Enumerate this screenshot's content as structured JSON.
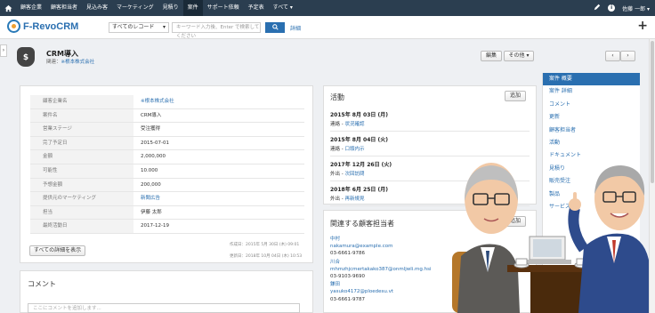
{
  "topnav": {
    "items": [
      "顧客企業",
      "顧客担当者",
      "見込み客",
      "マーケティング",
      "見積り",
      "案件",
      "サポート依頼",
      "予定表",
      "すべて ▾"
    ],
    "active_index": 5,
    "user": "佐藤 一郎 ▾"
  },
  "header": {
    "logo_text": "F-RevoCRM",
    "scope": "すべてのレコード",
    "search_placeholder": "キーワード入力後、Enter で検索してください",
    "advanced": "詳細"
  },
  "record": {
    "title": "CRM導入",
    "related_label": "関連：",
    "related_value": "※根本株式会社",
    "edit_button": "編集",
    "more_button": "その他 ▾"
  },
  "details": {
    "rows": [
      {
        "key": "顧客企業名",
        "value": "※根本株式会社",
        "link": true
      },
      {
        "key": "案件名",
        "value": "CRM導入",
        "link": false
      },
      {
        "key": "営業ステージ",
        "value": "受注獲得",
        "link": false
      },
      {
        "key": "完了予定日",
        "value": "2015-07-01",
        "link": false
      },
      {
        "key": "金額",
        "value": "2,000,000",
        "link": false
      },
      {
        "key": "可能性",
        "value": "10.000",
        "link": false
      },
      {
        "key": "予想金額",
        "value": "200,000",
        "link": false
      },
      {
        "key": "提供元のマーケティング",
        "value": "新聞広告",
        "link": true
      },
      {
        "key": "担当",
        "value": "伊藤 太郎",
        "link": false
      },
      {
        "key": "最終活動日",
        "value": "2017-12-19",
        "link": false
      }
    ],
    "all_details_button": "すべての詳細を表示",
    "created": "作成日：2015年 5月 30日 (木) 09:01",
    "modified": "更新日：2018年 10月 04日 (木) 10:53"
  },
  "comments": {
    "title": "コメント",
    "placeholder": "ここにコメントを追加します..."
  },
  "activities": {
    "title": "活動",
    "add_button": "追加",
    "items": [
      {
        "date": "2015年 8月 03日 (月)",
        "type": "連絡 - ",
        "subject": "状況確認"
      },
      {
        "date": "2015年 8月 04日 (火)",
        "type": "連絡 - ",
        "subject": "口頭内示"
      },
      {
        "date": "2017年 12月 26日 (火)",
        "type": "外出 - ",
        "subject": "次回訪問"
      },
      {
        "date": "2018年 6月 25日 (月)",
        "type": "外出 - ",
        "subject": "再新規見"
      }
    ]
  },
  "contacts": {
    "title": "関連する顧客担当者",
    "add_button": "追加",
    "items": [
      {
        "name": "中村",
        "email": "nakamura@example.com",
        "phone": "03-6661-9786"
      },
      {
        "name": "川合",
        "email": "mhmzhjcmertakako387@onmljwli.mg.hsi",
        "phone": "03-9103-9690"
      },
      {
        "name": "鎌田",
        "email": "yasuko4172@ploedesu.vt",
        "phone": "03-6661-9787"
      }
    ]
  },
  "sidebar": {
    "items": [
      "案件 概要",
      "案件 詳細",
      "コメント",
      "更新",
      "顧客担当者",
      "活動",
      "ドキュメント",
      "見積り",
      "販売受注",
      "製品",
      "サービス"
    ],
    "selected_index": 0
  },
  "colors": {
    "nav_bg": "#2b3e50",
    "accent": "#2a6fb0"
  }
}
